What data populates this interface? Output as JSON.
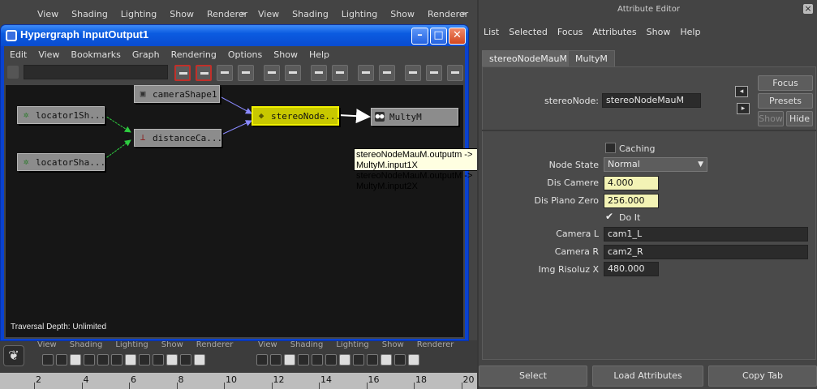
{
  "panel_menus": {
    "left": [
      "View",
      "Shading",
      "Lighting",
      "Show",
      "Renderer"
    ],
    "right": [
      "View",
      "Shading",
      "Lighting",
      "Show",
      "Renderer"
    ]
  },
  "hypergraph": {
    "title": "Hypergraph InputOutput1",
    "menus": [
      "Edit",
      "View",
      "Bookmarks",
      "Graph",
      "Rendering",
      "Options",
      "Show",
      "Help"
    ],
    "search_value": "",
    "nodes": {
      "camera_shape": "cameraShape1",
      "locator1": "locator1Sh...",
      "locator2": "locatorSha...",
      "distance": "distanceCa...",
      "stereo": "stereoNode...",
      "multy": "MultyM"
    },
    "tooltip": [
      "stereoNodeMauM.outputm -> MultyM.input1X",
      "stereoNodeMauM.outputM -> MultyM.input2X"
    ],
    "traversal": "Traversal Depth: Unlimited"
  },
  "ghost_menus": [
    "View",
    "Shading",
    "Lighting",
    "Show",
    "Renderer"
  ],
  "timeline": {
    "ticks": [
      "2",
      "4",
      "6",
      "8",
      "10",
      "12",
      "14",
      "16",
      "18",
      "20"
    ]
  },
  "attribute_editor": {
    "title": "Attribute Editor",
    "menus": [
      "List",
      "Selected",
      "Focus",
      "Attributes",
      "Show",
      "Help"
    ],
    "tabs": [
      "stereoNodeMauM",
      "MultyM"
    ],
    "node_label": "stereoNode:",
    "node_value": "stereoNodeMauM",
    "buttons": {
      "focus": "Focus",
      "presets": "Presets",
      "show": "Show",
      "hide": "Hide"
    },
    "caching_label": "Caching",
    "fields": {
      "node_state_label": "Node State",
      "node_state_value": "Normal",
      "dis_camere_label": "Dis Camere",
      "dis_camere_value": "4.000",
      "dis_piano_label": "Dis Piano Zero",
      "dis_piano_value": "256.000",
      "do_it_label": "Do It",
      "camera_l_label": "Camera L",
      "camera_l_value": "cam1_L",
      "camera_r_label": "Camera R",
      "camera_r_value": "cam2_R",
      "img_label": "Img Risoluz X",
      "img_value": "480.000"
    },
    "footer": {
      "select": "Select",
      "load": "Load Attributes",
      "copy": "Copy Tab"
    }
  }
}
